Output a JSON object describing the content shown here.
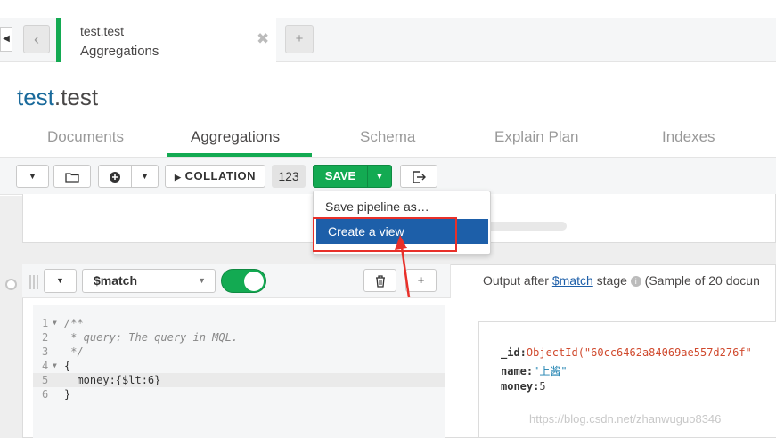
{
  "tab": {
    "namespace": "test.test",
    "subtitle": "Aggregations",
    "close": "✖",
    "new_tab": "+"
  },
  "title": {
    "db": "test",
    "collection": ".test"
  },
  "subtabs": [
    "Documents",
    "Aggregations",
    "Schema",
    "Explain Plan",
    "Indexes"
  ],
  "toolbar": {
    "collation_label": "COLLATION",
    "count": "123",
    "save_label": "SAVE"
  },
  "save_menu": {
    "items": [
      "Save pipeline as…",
      "Create a view"
    ],
    "highlighted": "Create a view"
  },
  "stage": {
    "operator": "$match",
    "code": [
      {
        "n": "1",
        "fold": "▼",
        "text": "/**"
      },
      {
        "n": "2",
        "fold": "",
        "text": " * query: The query in MQL."
      },
      {
        "n": "3",
        "fold": "",
        "text": " */"
      },
      {
        "n": "4",
        "fold": "▼",
        "text": "{"
      },
      {
        "n": "5",
        "fold": "",
        "text": "  money:{$lt:6}"
      },
      {
        "n": "6",
        "fold": "",
        "text": "}"
      }
    ]
  },
  "output": {
    "prefix": "Output after",
    "stage_link": "$match",
    "suffix": "stage",
    "info_icon": "i",
    "sample": "(Sample of 20 docun",
    "doc": {
      "id_key": "_id:",
      "id_val": "ObjectId(\"60cc6462a84069ae557d276f\"",
      "name_key": "name:",
      "name_val": "\"上酱\"",
      "money_key": "money:",
      "money_val": "5"
    }
  },
  "watermark": "https://blog.csdn.net/zhanwuguo8346",
  "colors": {
    "accent_green": "#13aa52",
    "link_blue": "#1d5fa9",
    "highlight_red": "#e8302a"
  }
}
